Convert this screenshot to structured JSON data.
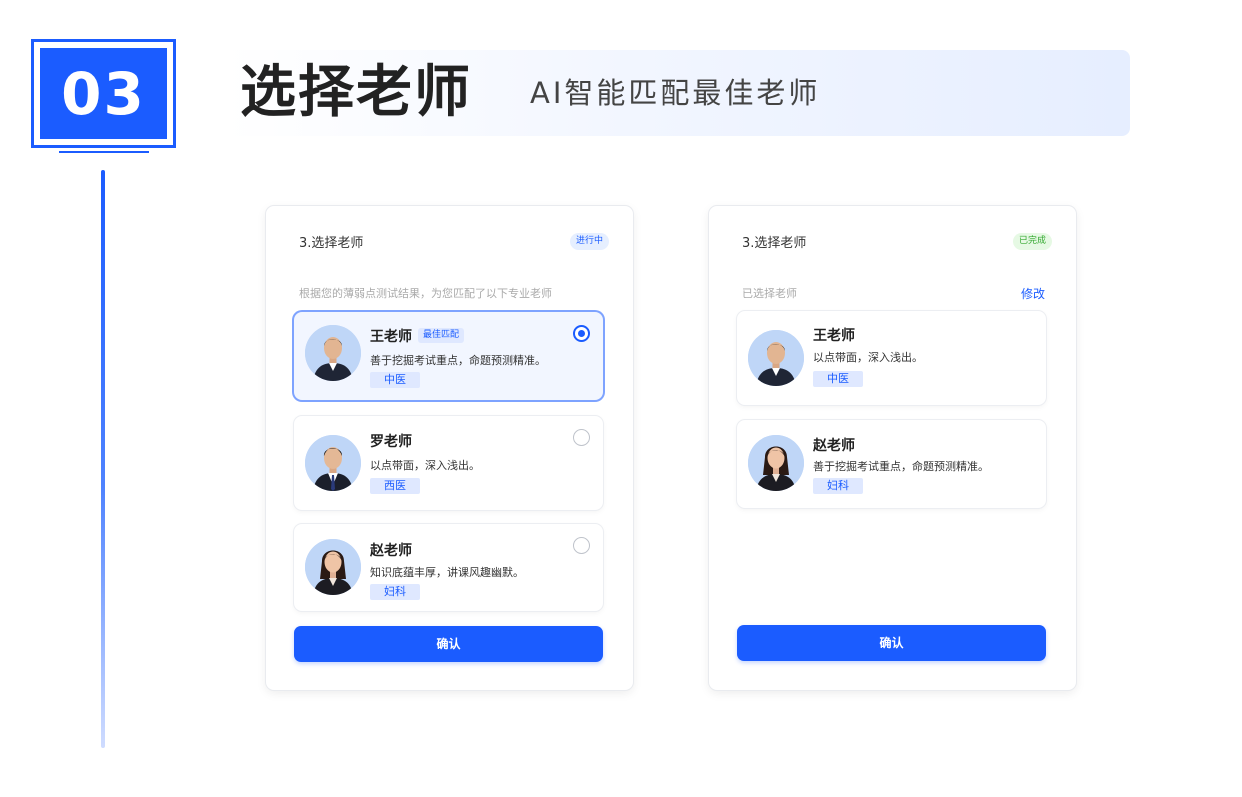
{
  "step": {
    "number": "03"
  },
  "header": {
    "title": "选择老师",
    "subtitle": "AI智能匹配最佳老师"
  },
  "colors": {
    "accent": "#1b5cff",
    "done": "#33a82f",
    "selected_bg": "#f2f6ff"
  },
  "left_panel": {
    "title": "3.选择老师",
    "status": "进行中",
    "hint": "根据您的薄弱点测试结果，为您匹配了以下专业老师",
    "teachers": [
      {
        "name": "王老师",
        "badge": "最佳匹配",
        "desc": "善于挖掘考试重点，命题预测精准。",
        "subject": "中医",
        "selected": true,
        "avatar": "male-teacher-avatar"
      },
      {
        "name": "罗老师",
        "desc": "以点带面，深入浅出。",
        "subject": "西医",
        "selected": false,
        "avatar": "male-teacher-avatar"
      },
      {
        "name": "赵老师",
        "desc": "知识底蕴丰厚，讲课风趣幽默。",
        "subject": "妇科",
        "selected": false,
        "avatar": "female-teacher-avatar"
      }
    ],
    "confirm_label": "确认"
  },
  "right_panel": {
    "title": "3.选择老师",
    "status": "已完成",
    "hint": "已选择老师",
    "modify_label": "修改",
    "teachers": [
      {
        "name": "王老师",
        "desc": "以点带面，深入浅出。",
        "subject": "中医",
        "avatar": "male-teacher-avatar"
      },
      {
        "name": "赵老师",
        "desc": "善于挖掘考试重点，命题预测精准。",
        "subject": "妇科",
        "avatar": "female-teacher-avatar"
      }
    ],
    "confirm_label": "确认"
  }
}
